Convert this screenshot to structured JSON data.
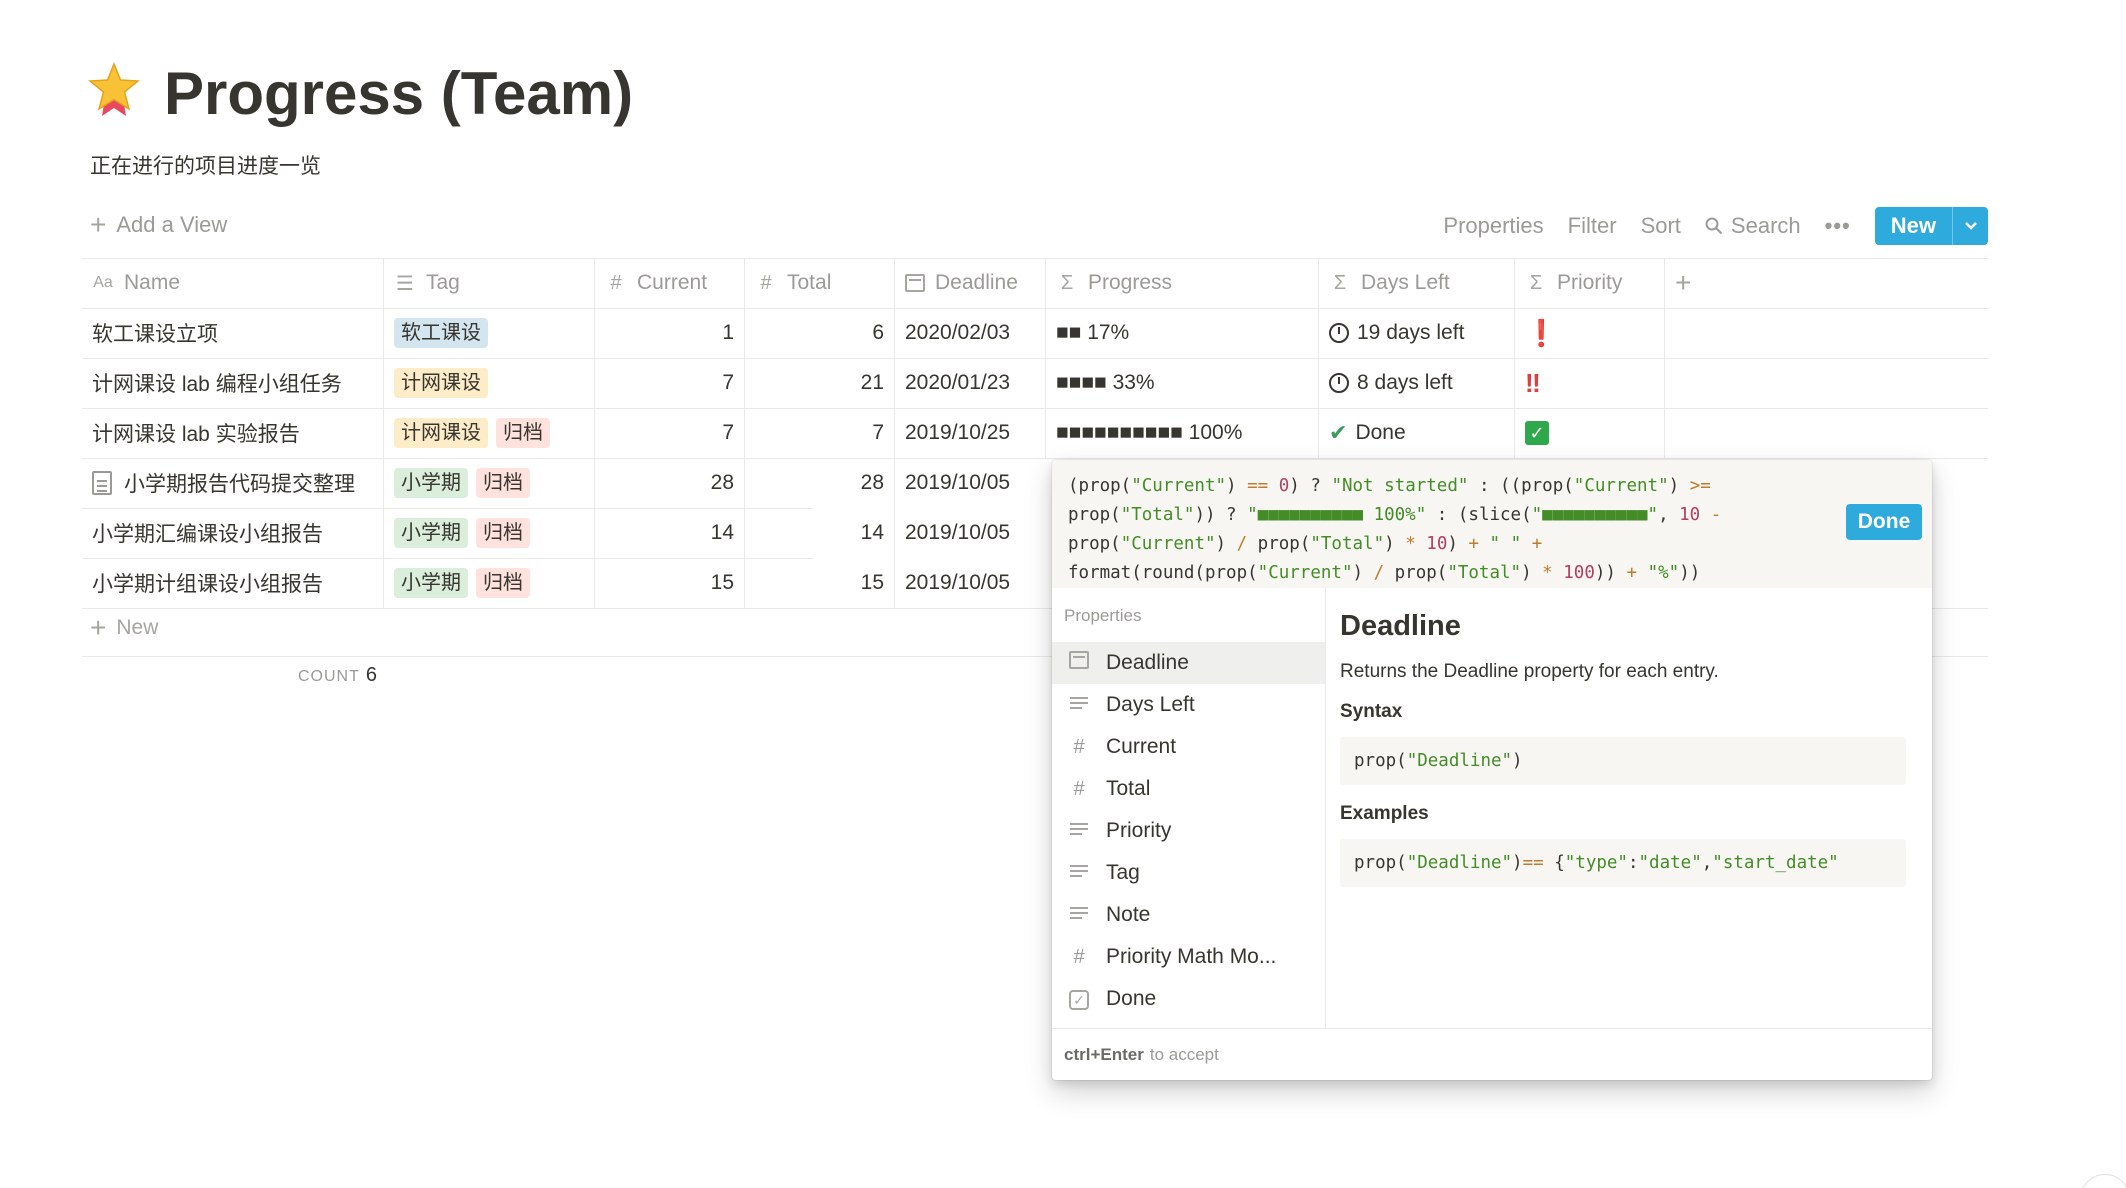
{
  "page": {
    "icon": "star-icon",
    "title": "Progress (Team)",
    "description": "正在进行的项目进度一览"
  },
  "toolbar": {
    "add_view": "Add a View",
    "properties": "Properties",
    "filter": "Filter",
    "sort": "Sort",
    "search": "Search",
    "more": "•••",
    "new": "New"
  },
  "table": {
    "headers": [
      "Name",
      "Tag",
      "Current",
      "Total",
      "Deadline",
      "Progress",
      "Days Left",
      "Priority"
    ],
    "rows": [
      {
        "name": "软工课设立项",
        "tags": [
          {
            "label": "软工课设",
            "color": "#d3e5ef"
          }
        ],
        "current": "1",
        "total": "6",
        "deadline": "2020/02/03",
        "progress": "■■ 17%",
        "days_left": "19 days left",
        "days_icon": "timer-icon",
        "priority": "❗"
      },
      {
        "name": "计网课设 lab 编程小组任务",
        "tags": [
          {
            "label": "计网课设",
            "color": "#fdecc8"
          }
        ],
        "current": "7",
        "total": "21",
        "deadline": "2020/01/23",
        "progress": "■■■■ 33%",
        "days_left": "8 days left",
        "days_icon": "timer-icon",
        "priority": "‼"
      },
      {
        "name": "计网课设 lab 实验报告",
        "tags": [
          {
            "label": "计网课设",
            "color": "#fdecc8"
          },
          {
            "label": "归档",
            "color": "#ffe2dd"
          }
        ],
        "current": "7",
        "total": "7",
        "deadline": "2019/10/25",
        "progress": "■■■■■■■■■■ 100%",
        "days_left": "Done",
        "days_icon": "check-icon",
        "priority": "✓"
      },
      {
        "name": "小学期报告代码提交整理",
        "tags": [
          {
            "label": "小学期",
            "color": "#dbeddb"
          },
          {
            "label": "归档",
            "color": "#ffe2dd"
          }
        ],
        "current": "28",
        "total": "28",
        "deadline": "2019/10/05"
      },
      {
        "name": "小学期汇编课设小组报告",
        "tags": [
          {
            "label": "小学期",
            "color": "#dbeddb"
          },
          {
            "label": "归档",
            "color": "#ffe2dd"
          }
        ],
        "current": "14",
        "total": "14",
        "deadline": "2019/10/05"
      },
      {
        "name": "小学期计组课设小组报告",
        "tags": [
          {
            "label": "小学期",
            "color": "#dbeddb"
          },
          {
            "label": "归档",
            "color": "#ffe2dd"
          }
        ],
        "current": "15",
        "total": "15",
        "deadline": "2019/10/05"
      }
    ],
    "new_row": "New",
    "count_label": "COUNT",
    "count_value": "6"
  },
  "formula_popup": {
    "done": "Done",
    "properties_label": "Properties",
    "properties": [
      {
        "label": "Deadline",
        "icon": "calendar-icon"
      },
      {
        "label": "Days Left",
        "icon": "text-lines-icon"
      },
      {
        "label": "Current",
        "icon": "hash-icon"
      },
      {
        "label": "Total",
        "icon": "hash-icon"
      },
      {
        "label": "Priority",
        "icon": "text-lines-icon"
      },
      {
        "label": "Tag",
        "icon": "text-lines-icon"
      },
      {
        "label": "Note",
        "icon": "text-lines-icon"
      },
      {
        "label": "Priority Math Mo...",
        "icon": "hash-icon"
      },
      {
        "label": "Done",
        "icon": "checkbox-icon"
      }
    ],
    "detail": {
      "title": "Deadline",
      "description": "Returns the Deadline property for each entry.",
      "syntax_label": "Syntax",
      "syntax": "prop(\"Deadline\")",
      "examples_label": "Examples",
      "example": "prop(\"Deadline\") == {\"type\":\"date\",\"start_date\""
    },
    "footer_key": "ctrl+Enter",
    "footer_text": "to accept"
  }
}
